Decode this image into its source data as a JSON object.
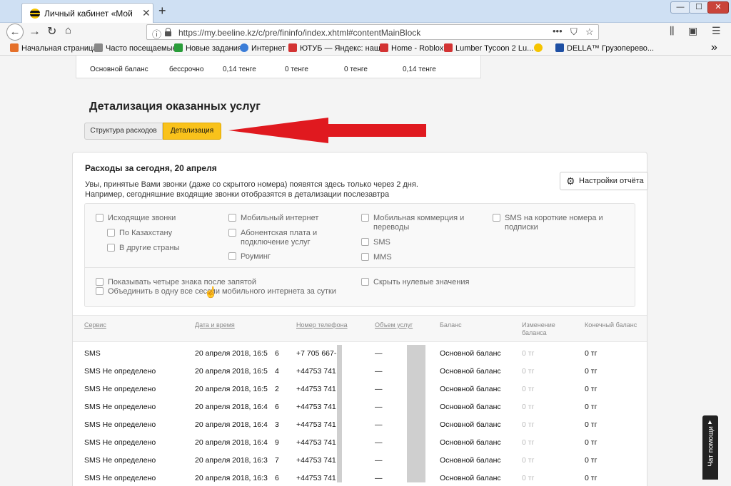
{
  "browser": {
    "tab_title": "Личный кабинет «Мой Beelin",
    "tab_close": "✕",
    "new_tab": "+",
    "window_controls": [
      "—",
      "☐",
      "✕"
    ],
    "url": "https://my.beeline.kz/c/pre/fininfo/index.xhtml#contentMainBlock",
    "url_menu": "•••",
    "bookmarks": [
      {
        "label": "Начальная страница",
        "color": "#e5702a"
      },
      {
        "label": "Часто посещаемые",
        "color": "#888888"
      },
      {
        "label": "Новые задания",
        "color": "#2a9d3a"
      },
      {
        "label": "Интернет",
        "color": "#3b7dd8"
      },
      {
        "label": "ЮТУБ — Яндекс: наш...",
        "color": "#d33333"
      },
      {
        "label": "Home - Roblox",
        "color": "#d33333"
      },
      {
        "label": "Lumber Tycoon 2  Lu...",
        "color": "#d33333"
      },
      {
        "label": "",
        "color": "#f5c400"
      },
      {
        "label": "DELLA™ Грузоперево...",
        "color": "#1e4fa3"
      }
    ],
    "bookmarks_more": "»"
  },
  "balance_row": {
    "name": "Основной баланс",
    "term": "бессрочно",
    "v1": "0,14 тенге",
    "v2": "0 тенге",
    "v3": "0 тенге",
    "v4": "0,14 тенге"
  },
  "page": {
    "title": "Детализация оказанных услуг",
    "tab_structure": "Структура расходов",
    "tab_details": "Детализация"
  },
  "card": {
    "title": "Расходы за сегодня, 20 апреля",
    "note": "Увы, принятые Вами звонки (даже со скрытого номера) появятся здесь только через 2 дня. Например, сегодняшние входящие звонки отобразятся в детализации послезавтра",
    "settings_label": "Настройки отчёта"
  },
  "filters": {
    "outgoing_calls": "Исходящие звонки",
    "in_kazakhstan": "По Казахстану",
    "to_other_countries": "В другие страны",
    "mobile_internet": "Мобильный интернет",
    "subscription_fee": "Абонентская плата и подключение услуг",
    "roaming": "Роуминг",
    "mobile_commerce": "Мобильная коммерция и переводы",
    "sms": "SMS",
    "mms": "MMS",
    "sms_short": "SMS на короткие номера и подписки",
    "four_decimals": "Показывать четыре знака после запятой",
    "merge_sessions": "Объединить в одну все сессии мобильного интернета за сутки",
    "hide_zero": "Скрыть нулевые значения"
  },
  "table": {
    "headers": {
      "service": "Сервис",
      "datetime": "Дата и время",
      "phone": "Номер телефона",
      "volume": "Объем услуг",
      "balance": "Баланс",
      "change": "Изменение баланса",
      "final": "Конечный баланс"
    },
    "rows": [
      {
        "service": "SMS",
        "datetime": "20 апреля 2018, 16:5",
        "digit": "6",
        "phone": "+7 705 667-",
        "volume": "—",
        "balance": "Основной баланс",
        "change": "0 тг",
        "final": "0 тг"
      },
      {
        "service": "SMS Не определено",
        "datetime": "20 апреля 2018, 16:5",
        "digit": "4",
        "phone": "+44753 741",
        "volume": "—",
        "balance": "Основной баланс",
        "change": "0 тг",
        "final": "0 тг"
      },
      {
        "service": "SMS Не определено",
        "datetime": "20 апреля 2018, 16:5",
        "digit": "2",
        "phone": "+44753 741",
        "volume": "—",
        "balance": "Основной баланс",
        "change": "0 тг",
        "final": "0 тг"
      },
      {
        "service": "SMS Не определено",
        "datetime": "20 апреля 2018, 16:4",
        "digit": "6",
        "phone": "+44753 741",
        "volume": "—",
        "balance": "Основной баланс",
        "change": "0 тг",
        "final": "0 тг"
      },
      {
        "service": "SMS Не определено",
        "datetime": "20 апреля 2018, 16:4",
        "digit": "3",
        "phone": "+44753 741",
        "volume": "—",
        "balance": "Основной баланс",
        "change": "0 тг",
        "final": "0 тг"
      },
      {
        "service": "SMS Не определено",
        "datetime": "20 апреля 2018, 16:4",
        "digit": "9",
        "phone": "+44753 741",
        "volume": "—",
        "balance": "Основной баланс",
        "change": "0 тг",
        "final": "0 тг"
      },
      {
        "service": "SMS Не определено",
        "datetime": "20 апреля 2018, 16:3",
        "digit": "7",
        "phone": "+44753 741",
        "volume": "—",
        "balance": "Основной баланс",
        "change": "0 тг",
        "final": "0 тг"
      },
      {
        "service": "SMS Не определено",
        "datetime": "20 апреля 2018, 16:3",
        "digit": "6",
        "phone": "+44753 741",
        "volume": "—",
        "balance": "Основной баланс",
        "change": "0 тг",
        "final": "0 тг"
      }
    ]
  },
  "help_tab": "Чат помощи",
  "colors": {
    "accent_yellow": "#f9c21b",
    "arrow_red": "#e0191f",
    "titlebar_blue": "#cfe0f3"
  }
}
